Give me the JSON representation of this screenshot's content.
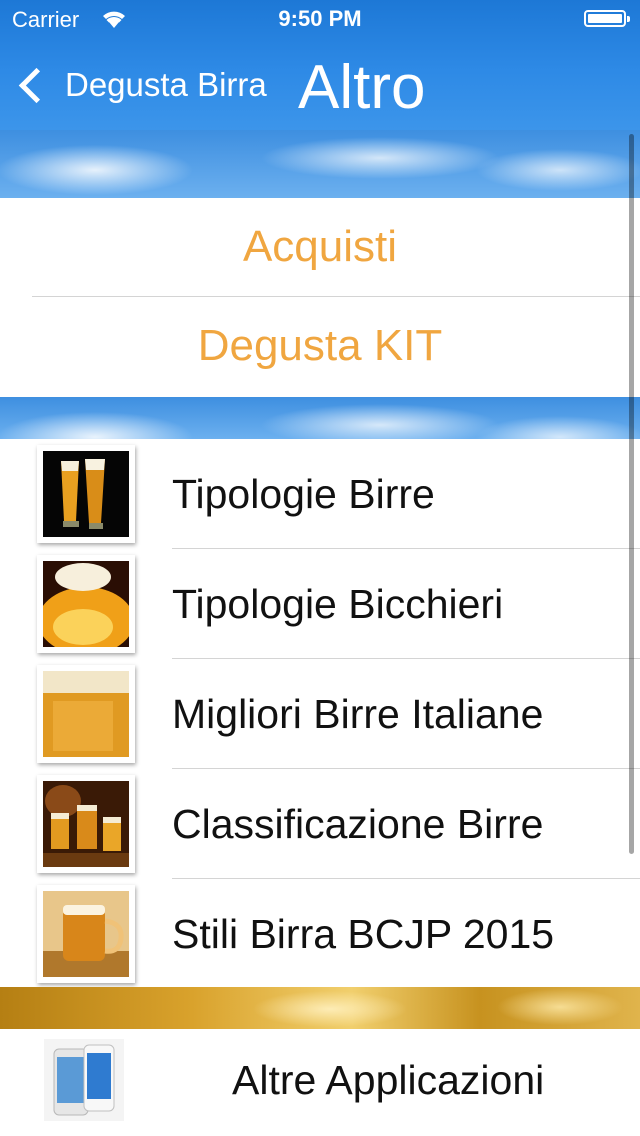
{
  "status_bar": {
    "carrier": "Carrier",
    "time": "9:50 PM"
  },
  "nav": {
    "back_label": "Degusta Birra",
    "title": "Altro"
  },
  "top_section": {
    "items": [
      {
        "label": "Acquisti"
      },
      {
        "label": "Degusta KIT"
      }
    ]
  },
  "list": {
    "items": [
      {
        "label": "Tipologie Birre",
        "icon": "beer-glasses-thumbnail"
      },
      {
        "label": "Tipologie Bicchieri",
        "icon": "beer-foam-thumbnail"
      },
      {
        "label": "Migliori Birre Italiane",
        "icon": "beer-closeup-thumbnail"
      },
      {
        "label": "Classificazione Birre",
        "icon": "beer-barrels-thumbnail"
      },
      {
        "label": "Stili Birra BCJP 2015",
        "icon": "beer-mug-thumbnail"
      }
    ]
  },
  "bottom": {
    "label": "Altre Applicazioni",
    "icon": "iphone-thumbnail"
  },
  "colors": {
    "nav_blue": "#1d78d6",
    "accent_orange": "#f0a640",
    "text": "#111111"
  }
}
